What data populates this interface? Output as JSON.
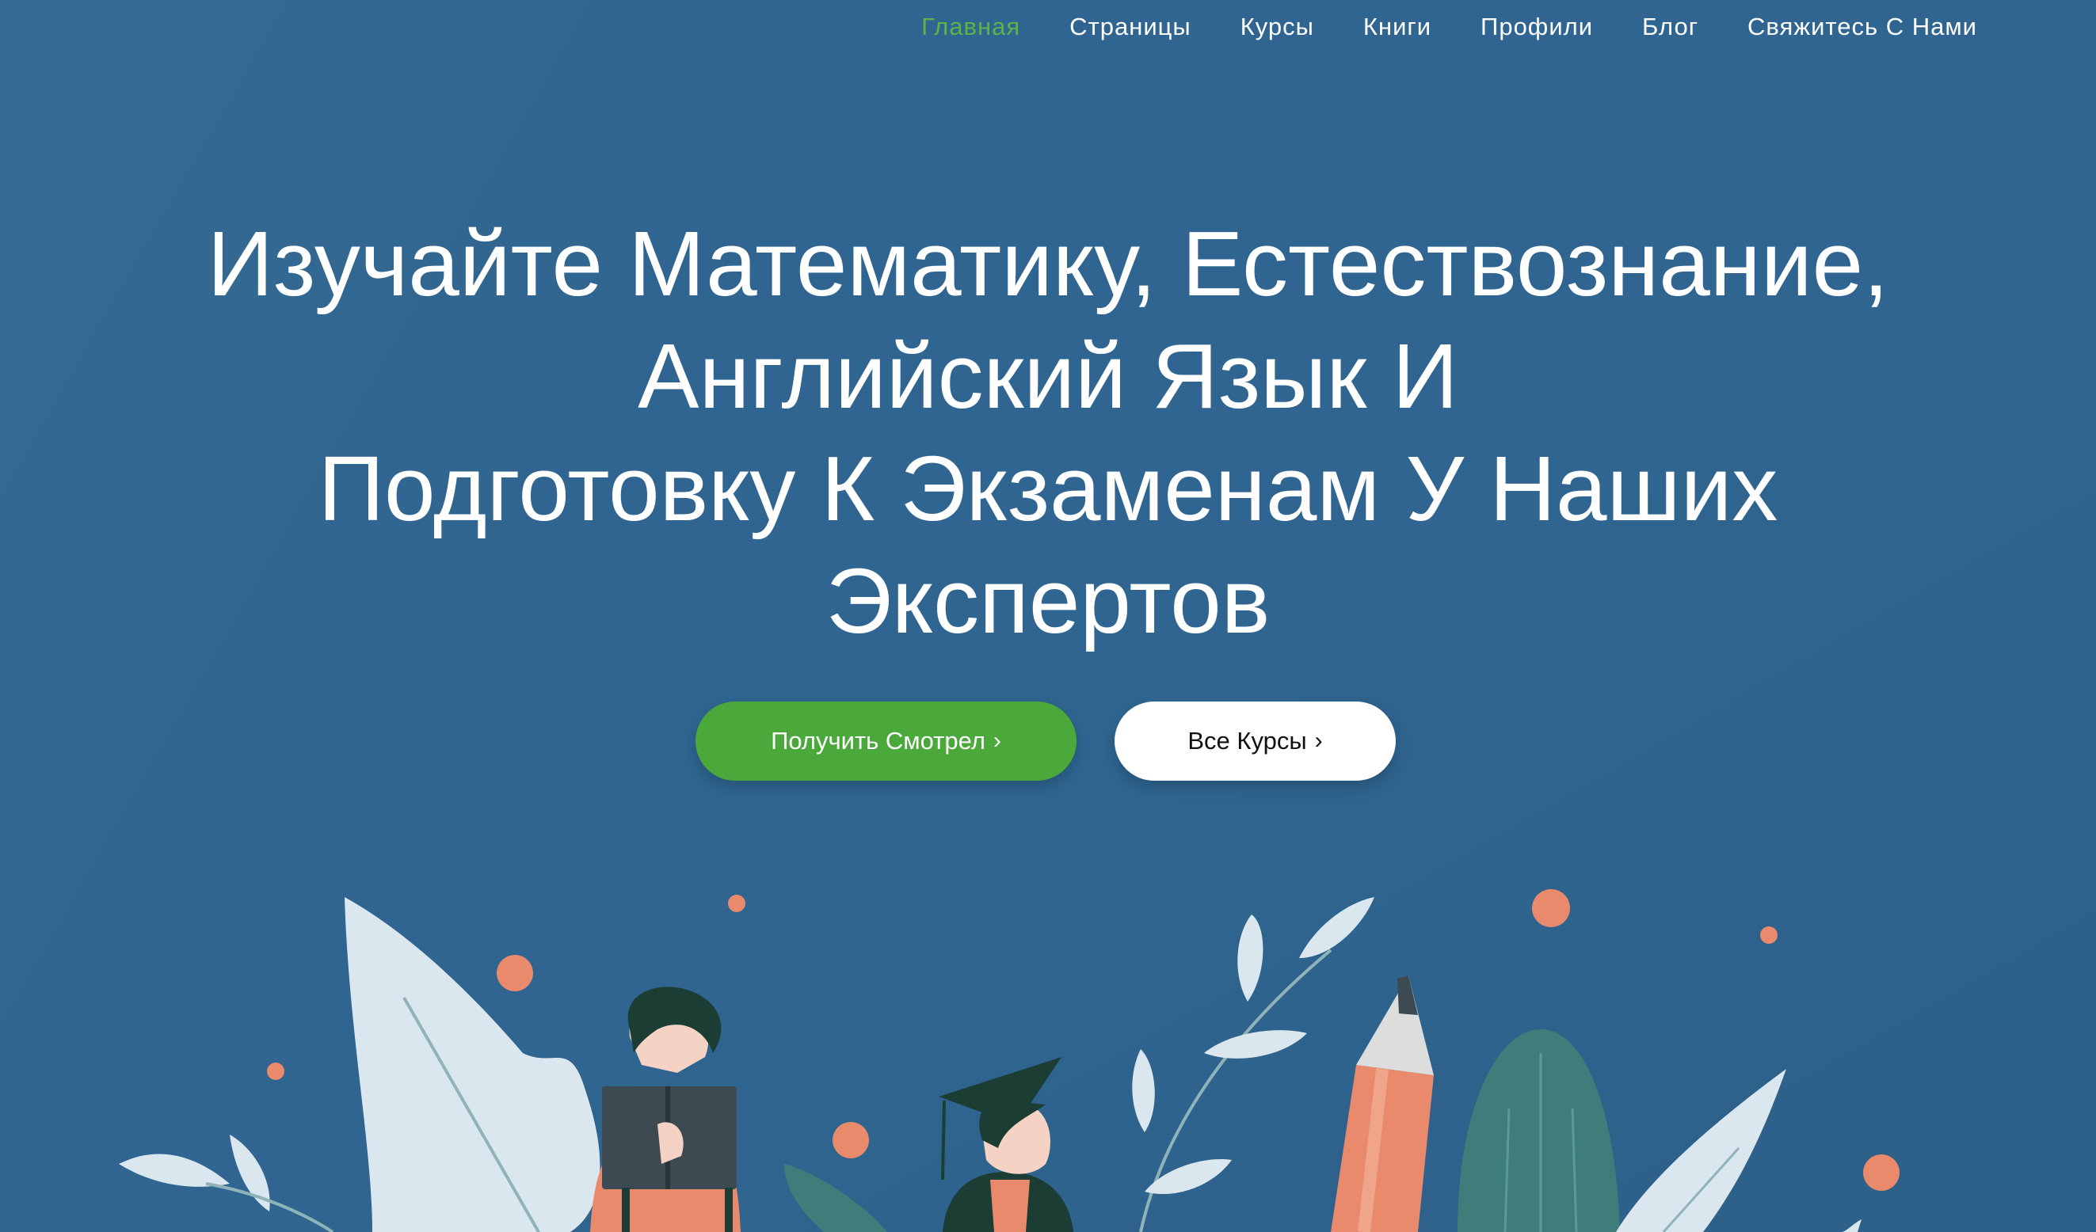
{
  "nav": {
    "items": [
      {
        "label": "Главная",
        "active": true
      },
      {
        "label": "Страницы",
        "active": false
      },
      {
        "label": "Курсы",
        "active": false
      },
      {
        "label": "Книги",
        "active": false
      },
      {
        "label": "Профили",
        "active": false
      },
      {
        "label": "Блог",
        "active": false
      },
      {
        "label": "Свяжитесь С Нами",
        "active": false
      }
    ]
  },
  "hero": {
    "title_lines": [
      "Изучайте Математику, Естествознание,",
      "Английский Язык И",
      "Подготовку К Экзаменам У Наших",
      "Экспертов"
    ],
    "primary_button": {
      "label": "Получить Смотрел",
      "icon": "chevron-right-icon"
    },
    "secondary_button": {
      "label": "Все Курсы",
      "icon": "chevron-right-icon"
    }
  },
  "colors": {
    "background": "#2f6590",
    "accent_green": "#4ba83a",
    "nav_active": "#5cb346",
    "text": "#ffffff"
  }
}
